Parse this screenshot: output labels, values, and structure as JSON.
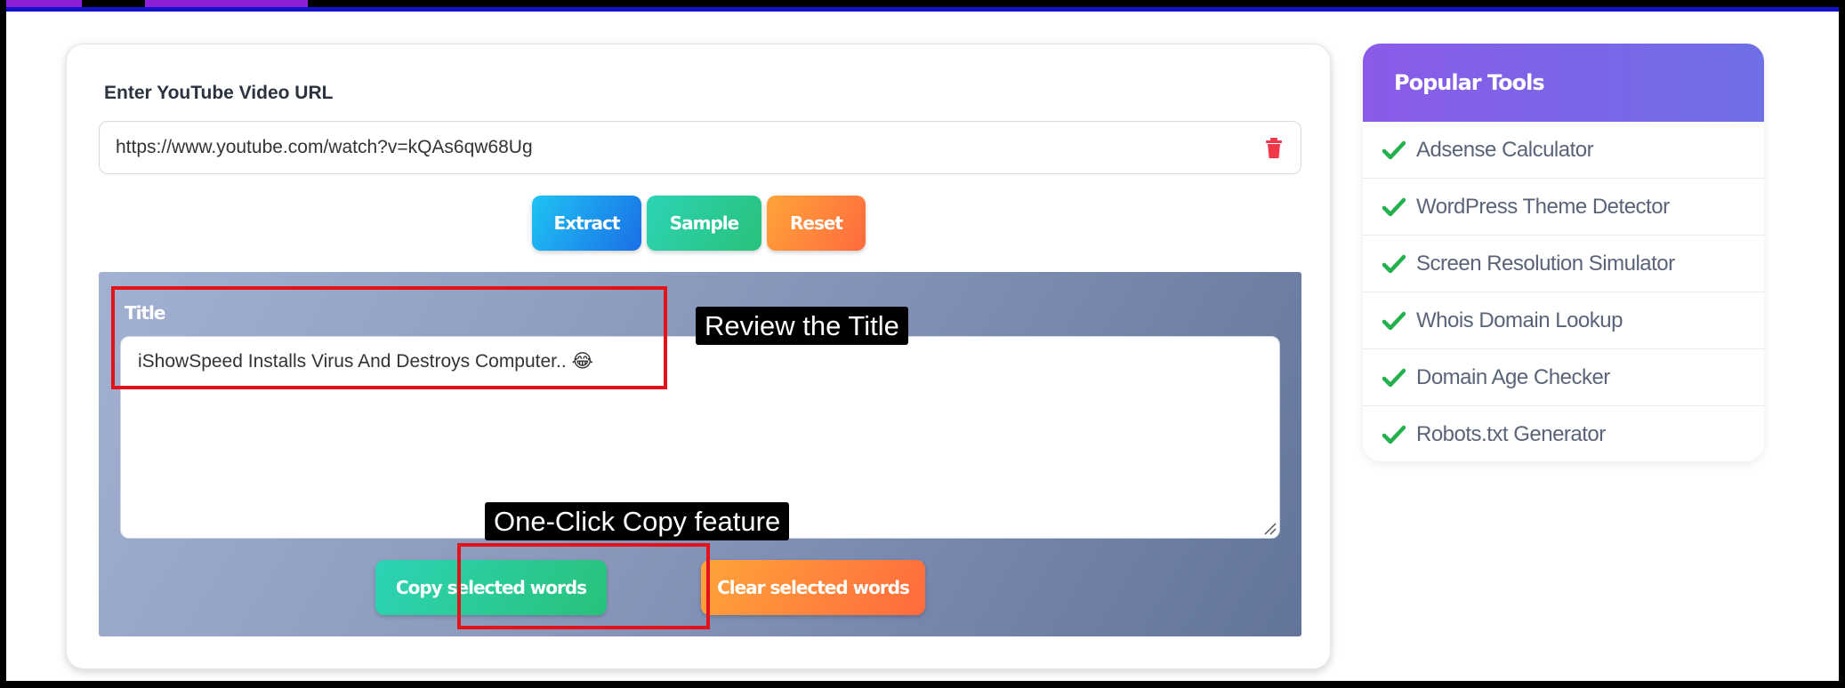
{
  "form": {
    "url_label": "Enter YouTube Video URL",
    "url_value": "https://www.youtube.com/watch?v=kQAs6qw68Ug",
    "buttons": {
      "extract": "Extract",
      "sample": "Sample",
      "reset": "Reset"
    }
  },
  "result": {
    "title_label": "Title",
    "title_value": "iShowSpeed Installs Virus And Destroys Computer.. 😂",
    "copy_button": "Copy selected words",
    "clear_button": "Clear selected words"
  },
  "annotations": {
    "review_title": "Review the Title",
    "copy_feature": "One-Click Copy feature"
  },
  "sidebar": {
    "title": "Popular Tools",
    "items": [
      {
        "label": "Adsense Calculator"
      },
      {
        "label": "WordPress Theme Detector"
      },
      {
        "label": "Screen Resolution Simulator"
      },
      {
        "label": "Whois Domain Lookup"
      },
      {
        "label": "Domain Age Checker"
      },
      {
        "label": "Robots.txt Generator"
      }
    ]
  },
  "colors": {
    "accent_purple": "#8a5be8",
    "annotation_red": "#e4131b",
    "check_green": "#22b14c",
    "trash_red": "#f0384a"
  }
}
